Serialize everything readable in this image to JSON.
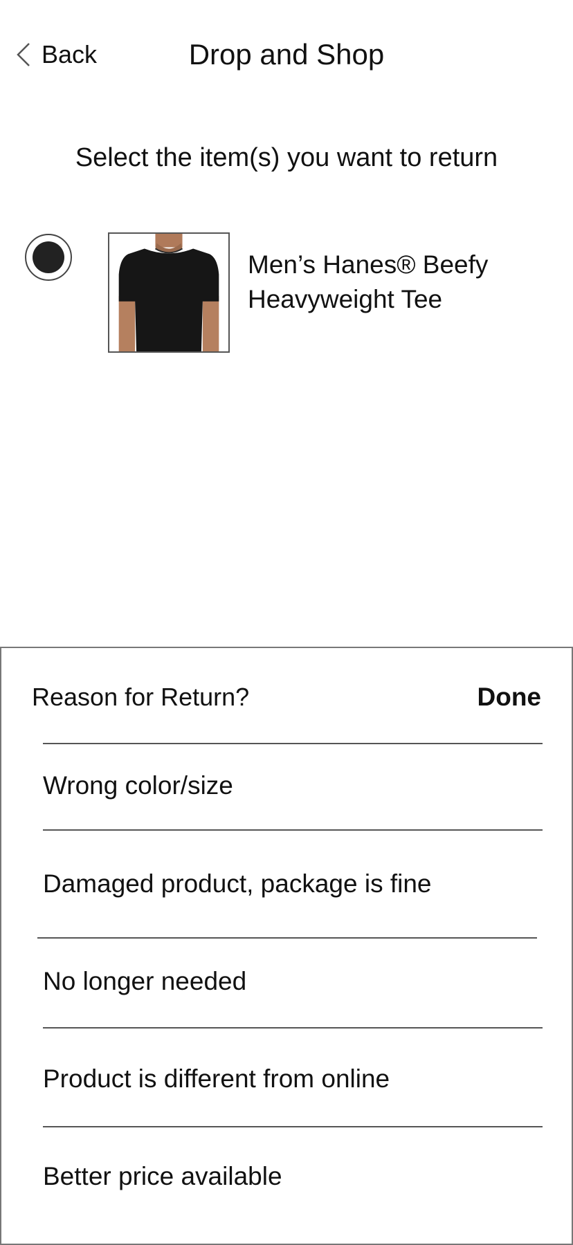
{
  "header": {
    "back_label": "Back",
    "title": "Drop and Shop",
    "back_icon": "chevron-left-icon"
  },
  "instruction": "Select the item(s) you want to return",
  "item": {
    "name": "Men’s Hanes® Beefy Heavyweight Tee",
    "selected": true,
    "image": "black-tshirt-photo"
  },
  "reason_sheet": {
    "title": "Reason for Return?",
    "done_label": "Done",
    "options": [
      "Wrong color/size",
      "Damaged product, package is fine",
      "No longer needed",
      "Product is different from online",
      "Better price available"
    ]
  },
  "colors": {
    "text": "#111111",
    "radio_fill": "#222222",
    "divider": "#555555",
    "sheet_border": "#777777"
  }
}
